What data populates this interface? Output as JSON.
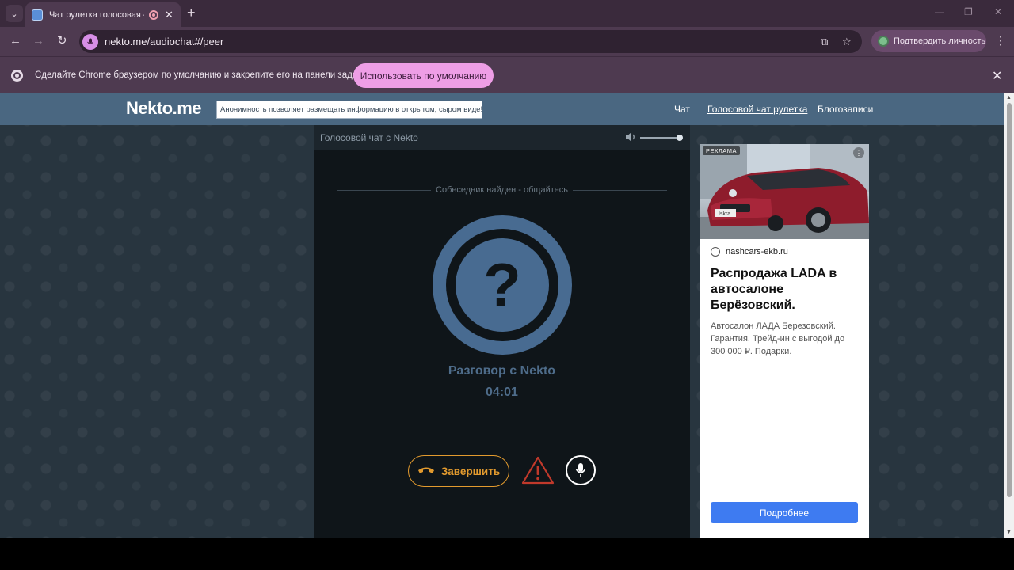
{
  "browser": {
    "tab_title": "Чат рулетка голосовая — N",
    "new_tab": "+",
    "url": "nekto.me/audiochat#/peer",
    "verify_label": "Подтвердить личность",
    "infobar_text": "Сделайте Chrome браузером по умолчанию и закрепите его на панели задач.",
    "infobar_button": "Использовать по умолчанию"
  },
  "site": {
    "logo": "Nekto.me",
    "tagline": "Анонимность позволяет размещать информацию в открытом, сыром виде!",
    "nav": [
      {
        "label": "Чат",
        "active": false
      },
      {
        "label": "Голосовой чат рулетка",
        "active": true
      },
      {
        "label": "Блогозаписи",
        "active": false
      }
    ]
  },
  "voice_chat": {
    "panel_title": "Голосовой чат с Nekto",
    "volume_level": 1.0,
    "status": "Собеседник найден - общайтесь",
    "avatar_symbol": "?",
    "call_title": "Разговор с Nekto",
    "timer": "04:01",
    "end_button": "Завершить",
    "colors": {
      "accent": "#486b91",
      "end": "#e29a2e",
      "report": "#c0392b"
    }
  },
  "ad": {
    "label": "РЕКЛАМА",
    "domain": "nashcars-ekb.ru",
    "title": "Распродажа LADA в автосалоне Берёзовский.",
    "description": "Автосалон ЛАДА Березовский. Гарантия. Трейд-ин с выгодой до 300 000 ₽. Подарки.",
    "cta": "Подробнее",
    "car_plate": "Iskra"
  }
}
